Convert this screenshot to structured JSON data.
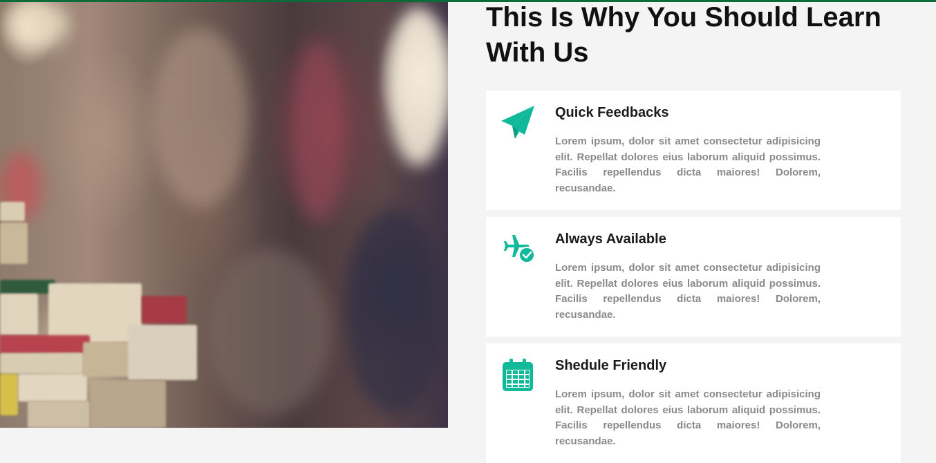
{
  "section": {
    "title": "This Is Why You Should Learn With Us"
  },
  "colors": {
    "accent": "#0fb99a",
    "top_bar": "#0d6b3a",
    "heading": "#111111",
    "body_text": "#8a8a8a",
    "card_bg": "#ffffff",
    "page_bg": "#f4f4f4"
  },
  "features": [
    {
      "icon": "paper-plane-icon",
      "title": "Quick Feedbacks",
      "text": "Lorem ipsum, dolor sit amet consectetur adipisicing elit. Repellat dolores eius laborum aliquid possimus. Facilis repellendus dicta maiores! Dolorem, recusandae."
    },
    {
      "icon": "plane-check-icon",
      "title": "Always Available",
      "text": "Lorem ipsum, dolor sit amet consectetur adipisicing elit. Repellat dolores eius laborum aliquid possimus. Facilis repellendus dicta maiores! Dolorem, recusandae."
    },
    {
      "icon": "calendar-icon",
      "title": "Shedule Friendly",
      "text": "Lorem ipsum, dolor sit amet consectetur adipisicing elit. Repellat dolores eius laborum aliquid possimus. Facilis repellendus dicta maiores! Dolorem, recusandae."
    }
  ]
}
